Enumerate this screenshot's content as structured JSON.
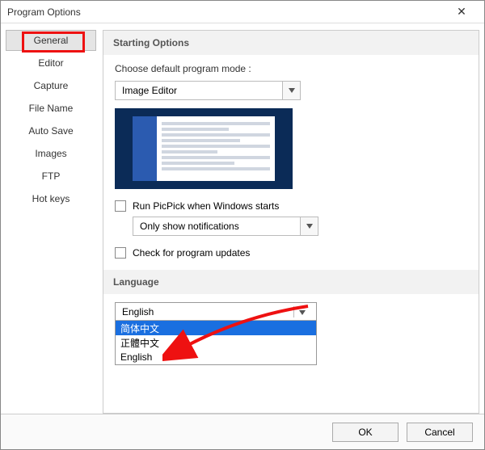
{
  "window": {
    "title": "Program Options"
  },
  "sidebar": {
    "items": [
      {
        "label": "General"
      },
      {
        "label": "Editor"
      },
      {
        "label": "Capture"
      },
      {
        "label": "File Name"
      },
      {
        "label": "Auto Save"
      },
      {
        "label": "Images"
      },
      {
        "label": "FTP"
      },
      {
        "label": "Hot keys"
      }
    ]
  },
  "sections": {
    "starting": {
      "header": "Starting Options",
      "choose_label": "Choose default program mode :",
      "mode_value": "Image Editor",
      "run_on_start": "Run PicPick when Windows starts",
      "tray_value": "Only show notifications",
      "check_updates": "Check for program updates"
    },
    "language": {
      "header": "Language",
      "value": "English",
      "options": [
        "简体中文",
        "正體中文",
        "English"
      ]
    }
  },
  "footer": {
    "ok": "OK",
    "cancel": "Cancel"
  }
}
